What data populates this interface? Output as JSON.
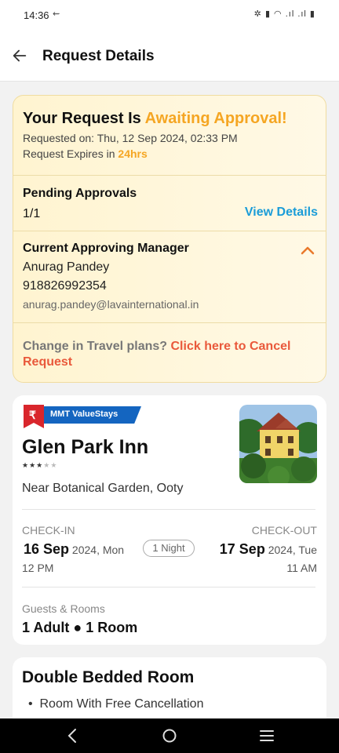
{
  "status": {
    "time": "14:36",
    "extra": "⇜",
    "icons": "✲ ▮ ◠ .ıl .ıl ▮"
  },
  "header": {
    "title": "Request Details"
  },
  "approval": {
    "title_prefix": "Your Request Is ",
    "title_status": "Awaiting Approval!",
    "requested_on": "Requested on: Thu, 12 Sep 2024, 02:33 PM",
    "expires_prefix": "Request Expires in ",
    "expires_value": "24hrs",
    "pending_label": "Pending Approvals",
    "pending_count": "1/1",
    "view_details": "View Details",
    "manager_heading": "Current Approving Manager",
    "manager_name": "Anurag Pandey",
    "manager_phone": "918826992354",
    "manager_email": "anurag.pandey@lavainternational.in",
    "change_prefix": "Change in Travel plans? ",
    "cancel_link": "Click here to Cancel Request"
  },
  "hotel": {
    "badge_symbol": "₹",
    "badge": "MMT ValueStays",
    "name": "Glen Park Inn",
    "star_rating": 3,
    "star_max": 5,
    "address": "Near Botanical Garden, Ooty",
    "checkin_label": "CHECK-IN",
    "checkout_label": "CHECK-OUT",
    "checkin_day": "16 Sep",
    "checkin_rest": " 2024, Mon",
    "checkin_time": "12 PM",
    "checkout_day": "17 Sep",
    "checkout_rest": " 2024, Tue",
    "checkout_time": "11 AM",
    "nights": "1 Night",
    "guests_label": "Guests & Rooms",
    "guests_value": "1 Adult ● 1 Room"
  },
  "room": {
    "title": "Double Bedded Room",
    "features": [
      "Room With Free Cancellation"
    ]
  },
  "colors": {
    "accent": "#f5a623",
    "link": "#1a9cd8",
    "cancel": "#e9593b",
    "badge": "#1465c0",
    "flag": "#d9262c"
  }
}
